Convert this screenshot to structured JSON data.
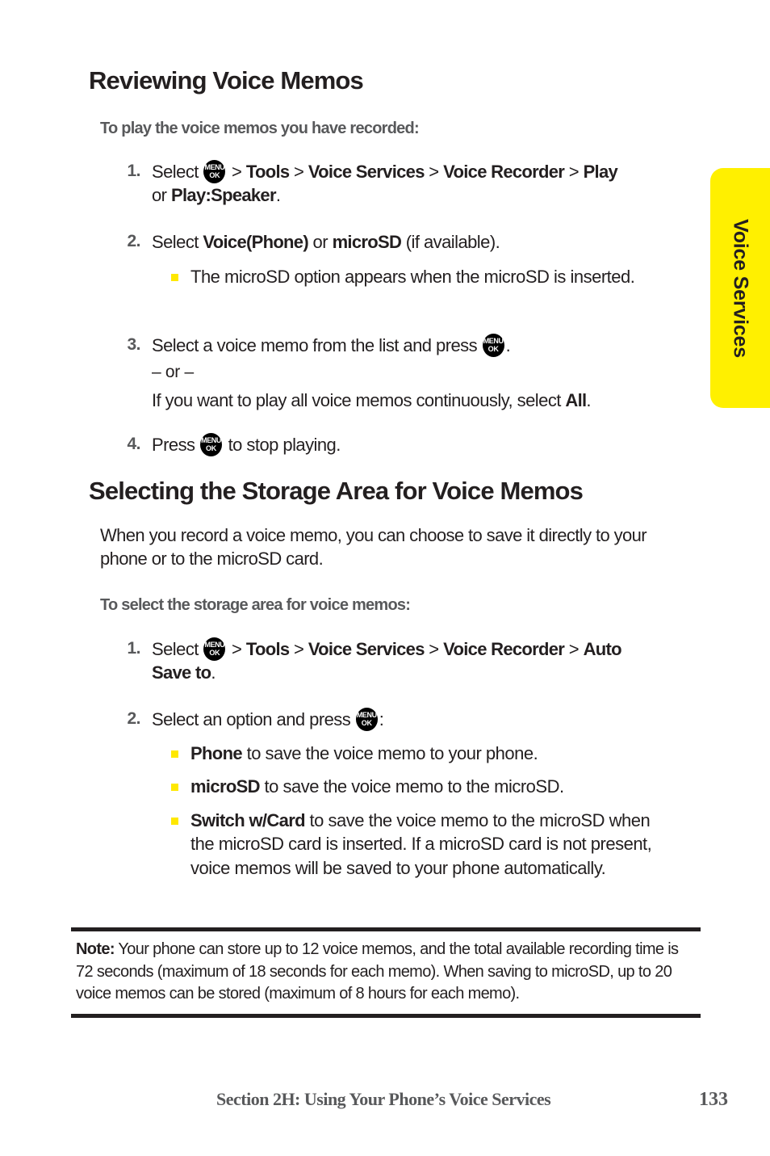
{
  "page": {
    "background": "#ffffff",
    "accent_yellow": "#fff000",
    "bullet_yellow": "#ffe800",
    "text_color": "#231f20",
    "muted_text_color": "#58595b"
  },
  "side_tab": {
    "label": "Voice Services"
  },
  "sections": [
    {
      "title": "Reviewing Voice Memos",
      "lead": "To play the voice memos you have recorded:",
      "steps": [
        {
          "number": "1.",
          "pre": "Select ",
          "icon": "menu-ok-key-icon",
          "post_plain_1": " > ",
          "bold_1": "Tools",
          "post_plain_2": " > ",
          "bold_2": "Voice Services",
          "post_plain_3": " > ",
          "bold_3": "Voice Recorder",
          "post_plain_4": " > ",
          "bold_4": "Play",
          "post_plain_5": " or ",
          "bold_5": "Play:Speaker",
          "post_plain_6": "."
        },
        {
          "number": "2.",
          "pre": "Select ",
          "bold_1": "Voice(Phone)",
          "mid": " or ",
          "bold_2": "microSD",
          "post": " (if available)."
        },
        {
          "number": "3.",
          "pre": "Select a voice memo from the list and press ",
          "icon": "menu-ok-key-icon",
          "post": ".",
          "or_text": "– or –",
          "alt_pre": "If you want to play all voice memos continuously, select ",
          "alt_bold": "All",
          "alt_post": "."
        },
        {
          "number": "4.",
          "pre": "Press ",
          "icon": "menu-ok-key-icon",
          "post": " to stop playing."
        }
      ],
      "sub_bullets": [
        {
          "after_step": "2.",
          "text": "The microSD option appears when the microSD is inserted."
        }
      ]
    },
    {
      "title": "Selecting the Storage Area for Voice Memos",
      "paragraph": "When you record a voice memo, you can choose to save it directly to your phone or to the microSD card.",
      "lead": "To select the storage area for voice memos:",
      "steps": [
        {
          "number": "1.",
          "pre": "Select ",
          "icon": "menu-ok-key-icon",
          "post_plain_1": " > ",
          "bold_1": "Tools",
          "post_plain_2": " > ",
          "bold_2": "Voice Services",
          "post_plain_3": " > ",
          "bold_3": "Voice Recorder",
          "post_plain_4": " > ",
          "bold_4": "Auto Save to",
          "post_plain_5": "."
        },
        {
          "number": "2.",
          "pre": "Select an option and press ",
          "icon": "menu-ok-key-icon",
          "post": ":"
        }
      ],
      "option_bullets": [
        {
          "bold": "Phone",
          "text": " to save the voice memo to your phone."
        },
        {
          "bold": "microSD",
          "text": " to save the voice memo to the microSD."
        },
        {
          "bold": "Switch w/Card",
          "text": " to save the voice memo to the microSD when the microSD card is inserted. If a microSD card is not present, voice memos will be saved to your phone automatically."
        }
      ]
    }
  ],
  "note": {
    "label": "Note:",
    "text": " Your phone can store up to 12 voice memos, and the total available recording time is 72 seconds (maximum of 18 seconds for each memo). When saving to microSD, up to 20 voice memos can be stored (maximum of 8 hours for each memo)."
  },
  "footer": {
    "section_label": "Section 2H: Using Your Phone’s Voice Services",
    "page_number": "133"
  },
  "menu_key": {
    "line1": "MENU",
    "line2": "OK"
  }
}
